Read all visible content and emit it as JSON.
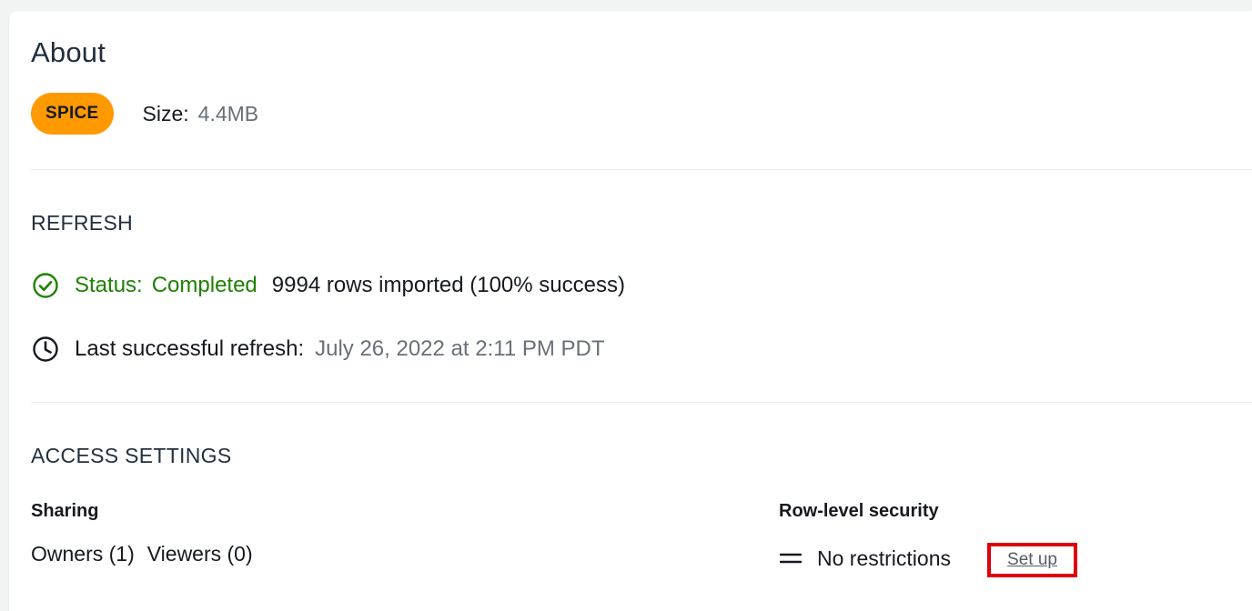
{
  "card": {
    "title": "About"
  },
  "about": {
    "badge": "SPICE",
    "size_label": "Size:",
    "size_value": "4.4MB"
  },
  "refresh": {
    "heading": "REFRESH",
    "status_label": "Status:",
    "status_value": "Completed",
    "rows_imported": "9994 rows imported (100% success)",
    "last_refresh_label": "Last successful refresh:",
    "last_refresh_value": "July 26, 2022 at 2:11 PM PDT"
  },
  "access": {
    "heading": "ACCESS SETTINGS",
    "sharing": {
      "heading": "Sharing",
      "owners": "Owners (1)",
      "viewers": "Viewers (0)"
    },
    "rls": {
      "heading": "Row-level security",
      "value": "No restrictions",
      "link": "Set up"
    }
  },
  "colors": {
    "badge": "#ff9900",
    "status_green": "#1d8102",
    "muted_text": "#687078",
    "highlight_box": "#e0000a"
  },
  "icons": {
    "status": "check-circle-icon",
    "refresh": "clock-icon",
    "rls": "equals-icon"
  }
}
